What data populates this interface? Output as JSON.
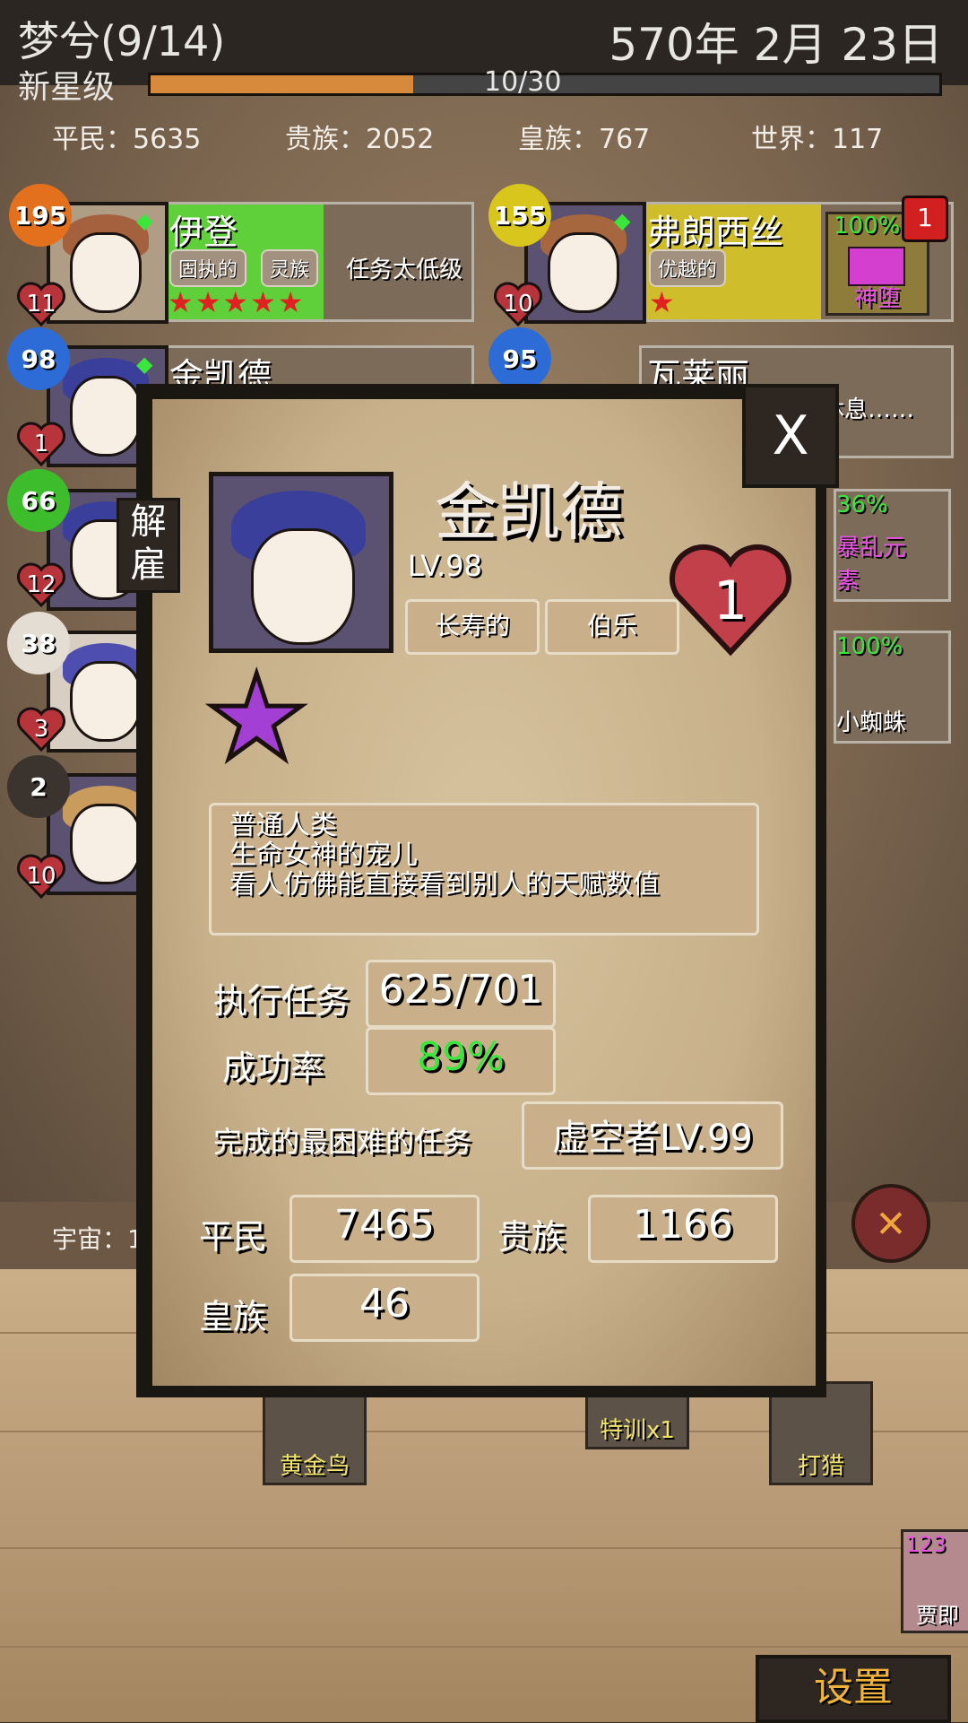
{
  "header": {
    "title": "梦兮(9/14)",
    "date": "570年 2月 23日",
    "rank": "新星级",
    "xp_text": "10/30",
    "xp_fraction": 0.333
  },
  "stats": [
    {
      "label": "平民：5635"
    },
    {
      "label": "贵族：2052"
    },
    {
      "label": "皇族：767"
    },
    {
      "label": "世界：117"
    }
  ],
  "roster_left": [
    {
      "level": "195",
      "hearts": "11",
      "name": "伊登",
      "tags": [
        "固执的",
        "灵族"
      ],
      "note": "任务太低级",
      "stars": 5
    },
    {
      "level": "98",
      "hearts": "1",
      "name": "金凯德"
    },
    {
      "level": "66",
      "hearts": "12"
    },
    {
      "level": "38",
      "hearts": "3"
    },
    {
      "level": "2",
      "hearts": "10"
    }
  ],
  "roster_right": [
    {
      "level": "155",
      "hearts": "10",
      "name": "弗朗西丝",
      "tags": [
        "优越的"
      ],
      "stars": 1,
      "task_percent": "100%",
      "task_name": "神堕",
      "task_alert": "1"
    },
    {
      "level": "95",
      "name": "瓦莱丽",
      "note": "休息……"
    }
  ],
  "side_tasks": [
    {
      "percent": "36%",
      "name": "暴乱元素"
    },
    {
      "percent": "100%",
      "name": "小蜘蛛"
    }
  ],
  "universe_label": "宇宙：1",
  "quests": [
    {
      "name": "黄金鸟"
    },
    {
      "name": "特训x1"
    },
    {
      "name": "打猎"
    }
  ],
  "corner_card": {
    "level": "123",
    "name": "贾即"
  },
  "settings_label": "设置",
  "modal": {
    "close_label": "X",
    "fire_label": "解雇",
    "name": "金凯德",
    "level": "LV.98",
    "traits": [
      "长寿的",
      "伯乐"
    ],
    "hearts": "1",
    "description": [
      "普通人类",
      "生命女神的宠儿",
      "看人仿佛能直接看到别人的天赋数值"
    ],
    "missions_label": "执行任务",
    "missions_value": "625/701",
    "success_label": "成功率",
    "success_value": "89%",
    "hardest_label": "完成的最困难的任务",
    "hardest_value": "虚空者LV.99",
    "commoners_label": "平民",
    "commoners_value": "7465",
    "nobles_label": "贵族",
    "nobles_value": "1166",
    "royals_label": "皇族",
    "royals_value": "46"
  },
  "colors": {
    "xp": "#d78a3c",
    "success": "#39e63b",
    "star_purple": "#a43fd6",
    "star_red": "#e12121"
  }
}
